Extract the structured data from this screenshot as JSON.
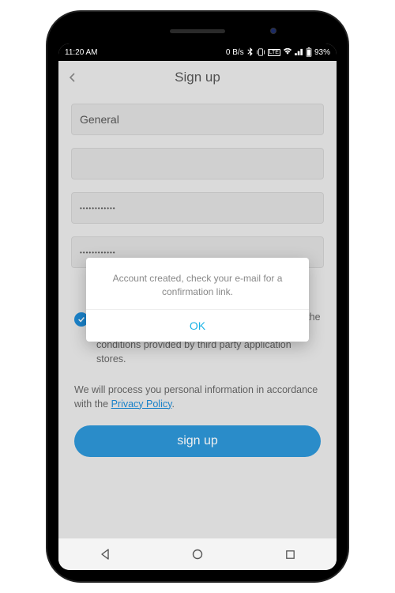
{
  "status": {
    "time": "11:20 AM",
    "network_speed": "0 B/s",
    "battery": "93%"
  },
  "header": {
    "title": "Sign up"
  },
  "form": {
    "field1_value": "General",
    "field2_value": "",
    "password1_masked": "••••••••••••",
    "password2_masked": "••••••••••••"
  },
  "consent": {
    "text": "By checking this box, you agree to be bound by the Terms of Service, and additional terms and conditions provided by third party application stores."
  },
  "privacy": {
    "prefix": "We will process you personal information in accordance with the ",
    "link_text": "Privacy Policy",
    "suffix": "."
  },
  "button": {
    "signup": "sign up"
  },
  "dialog": {
    "message": "Account created, check your e-mail for a confirmation link.",
    "ok": "OK"
  }
}
